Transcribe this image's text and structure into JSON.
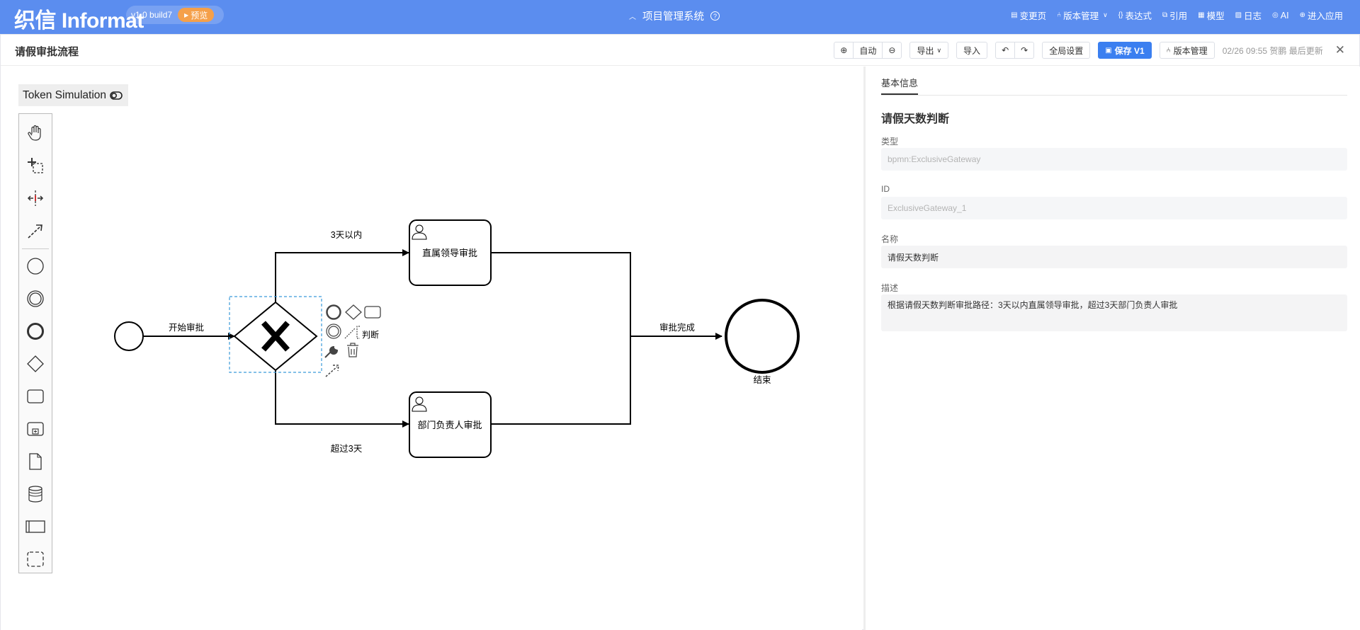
{
  "app": {
    "logo": "织信 Informat",
    "version": "v1.0 build7",
    "preview_label": "预览",
    "system_name": "项目管理系统"
  },
  "topnav": [
    {
      "icon": "changelog-icon",
      "glyph": "▤",
      "label": "变更页"
    },
    {
      "icon": "branch-icon",
      "glyph": "⑃",
      "label": "版本管理"
    },
    {
      "icon": "braces-icon",
      "glyph": "{}",
      "label": "表达式"
    },
    {
      "icon": "link-icon",
      "glyph": "⧉",
      "label": "引用"
    },
    {
      "icon": "grid-icon",
      "glyph": "▦",
      "label": "模型"
    },
    {
      "icon": "log-icon",
      "glyph": "▨",
      "label": "日志"
    },
    {
      "icon": "ai-icon",
      "glyph": "◎",
      "label": "AI"
    },
    {
      "icon": "enter-app-icon",
      "glyph": "⊕",
      "label": "进入应用"
    }
  ],
  "page": {
    "title": "请假审批流程"
  },
  "toolbar": {
    "zoom_auto": "自动",
    "export": "导出",
    "import": "导入",
    "global_settings": "全局设置",
    "save": "保存 V1",
    "version_manage": "版本管理",
    "status": "02/26 09:55 贺鹏 最后更新"
  },
  "canvas": {
    "token_simulation": "Token Simulation",
    "palette_tools": [
      "hand-tool-icon",
      "lasso-tool-icon",
      "space-tool-icon",
      "global-connect-icon",
      "start-event-icon",
      "intermediate-event-icon",
      "end-event-icon",
      "gateway-icon",
      "task-icon",
      "subprocess-icon",
      "data-object-icon",
      "data-store-icon",
      "pool-icon",
      "group-icon"
    ]
  },
  "diagram": {
    "start_flow_label": "开始审批",
    "upper_flow_label": "3天以内",
    "lower_flow_label": "超过3天",
    "merge_flow_label": "审批完成",
    "task_1": "直属领导审批",
    "task_2": "部门负责人审批",
    "end_label": "结束",
    "context_annotation": "判断"
  },
  "properties": {
    "tab": "基本信息",
    "heading": "请假天数判断",
    "type_label": "类型",
    "type_value": "bpmn:ExclusiveGateway",
    "id_label": "ID",
    "id_value": "ExclusiveGateway_1",
    "name_label": "名称",
    "name_value": "请假天数判断",
    "desc_label": "描述",
    "desc_value": "根据请假天数判断审批路径：3天以内直属领导审批，超过3天部门负责人审批"
  }
}
